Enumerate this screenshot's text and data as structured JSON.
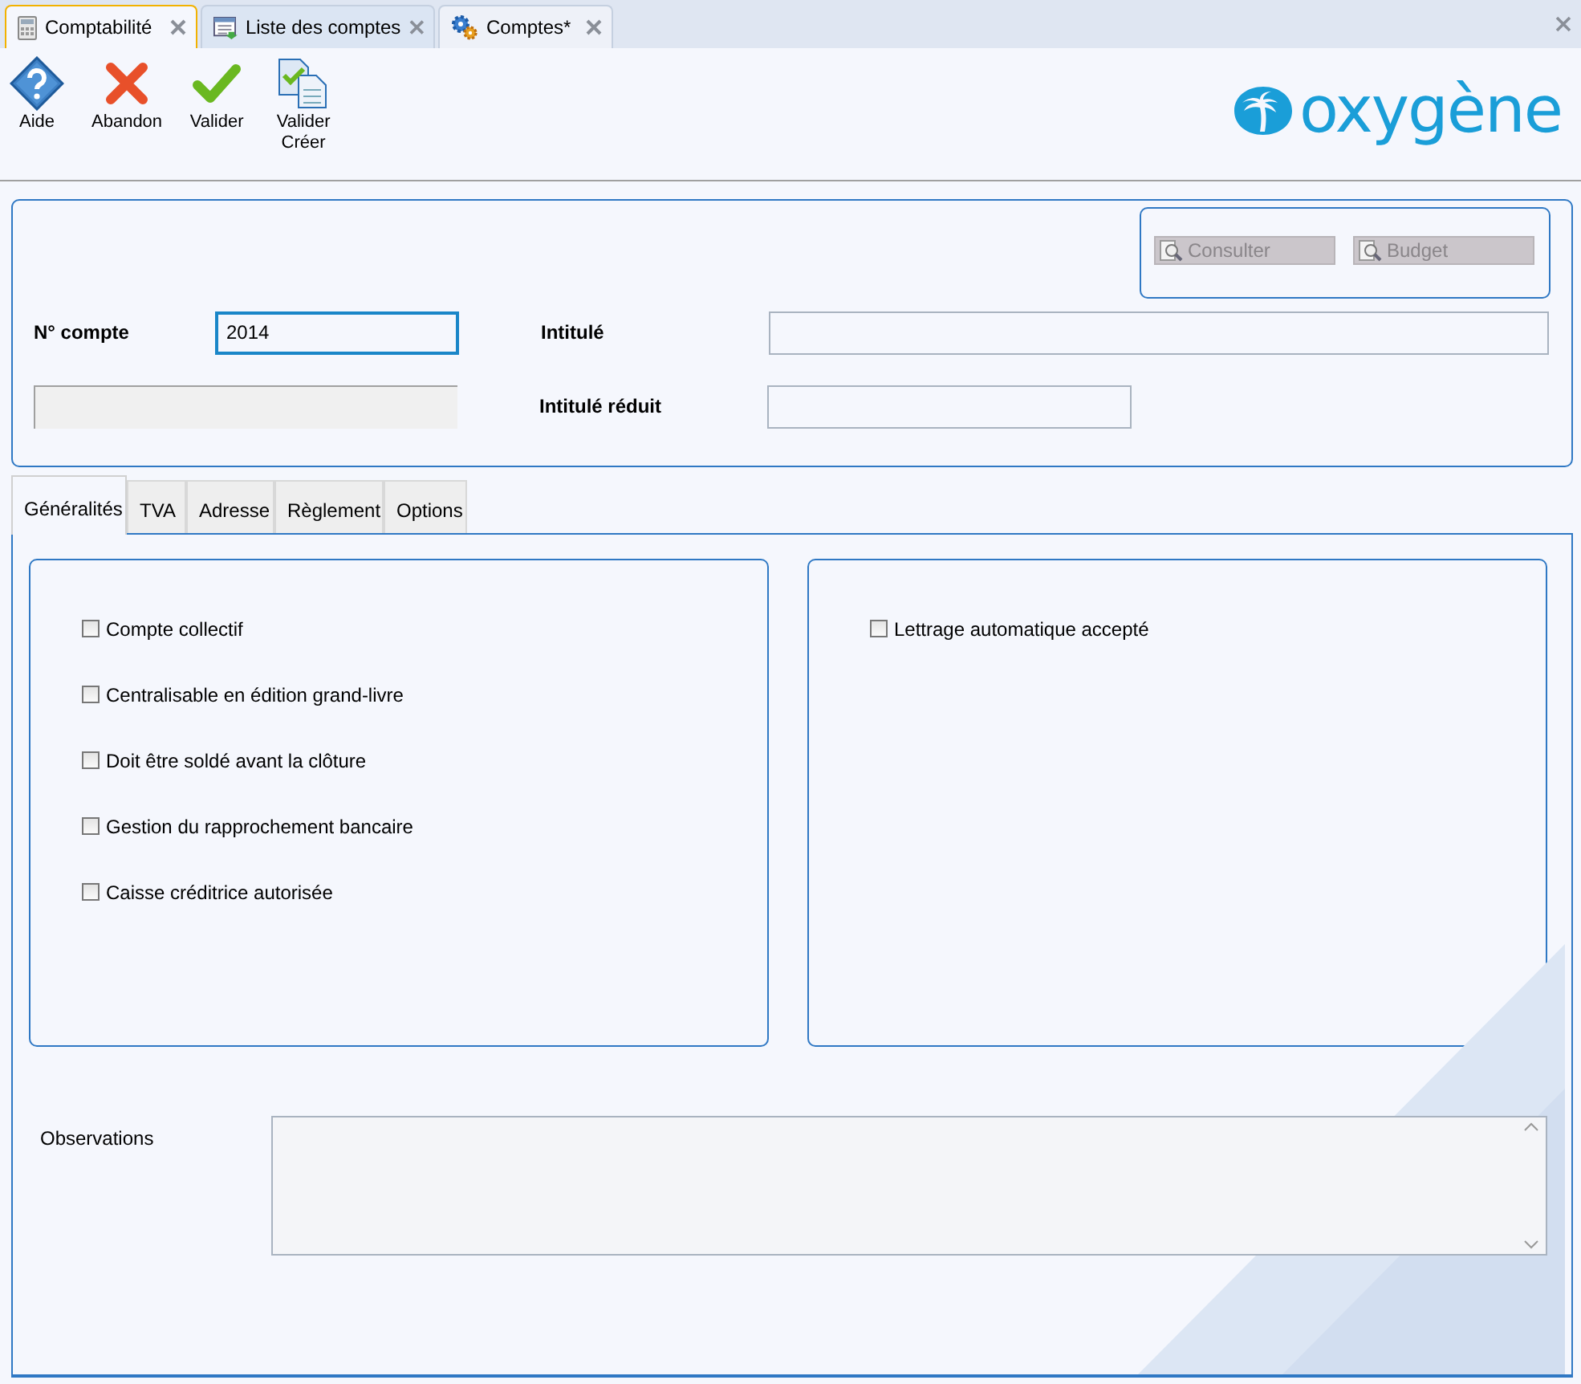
{
  "doc_tabs": [
    {
      "label": "Comptabilité",
      "selected": true
    },
    {
      "label": "Liste des comptes",
      "selected": false
    },
    {
      "label": "Comptes*",
      "selected": false
    }
  ],
  "toolbar": [
    {
      "label": "Aide"
    },
    {
      "label": "Abandon"
    },
    {
      "label": "Valider"
    },
    {
      "label": "Valider\nCréer"
    }
  ],
  "logo": "oxygène",
  "header": {
    "buttons": [
      {
        "label": "Consulter",
        "disabled": true
      },
      {
        "label": "Budget",
        "disabled": true
      }
    ],
    "account_number": {
      "label": "N° compte",
      "value": "2014",
      "focused": true
    },
    "secondary_field": {
      "disabled": true
    },
    "title": {
      "label": "Intitulé"
    },
    "short_title": {
      "label": "Intitulé réduit"
    }
  },
  "tabs": [
    {
      "label": "Généralités",
      "selected": true
    },
    {
      "label": "TVA",
      "selected": false
    },
    {
      "label": "Adresse",
      "selected": false
    },
    {
      "label": "Règlement",
      "selected": false
    },
    {
      "label": "Options",
      "selected": false
    }
  ],
  "left_options": [
    {
      "label": "Compte collectif",
      "checked": false
    },
    {
      "label": "Centralisable en édition grand-livre",
      "checked": false
    },
    {
      "label": "Doit être soldé avant la clôture",
      "checked": false
    },
    {
      "label": "Gestion du rapprochement bancaire",
      "checked": false
    },
    {
      "label": "Caisse créditrice autorisée",
      "checked": false
    }
  ],
  "right_options": [
    {
      "label": "Lettrage automatique accepté",
      "checked": false
    }
  ],
  "observations": {
    "label": "Observations"
  }
}
